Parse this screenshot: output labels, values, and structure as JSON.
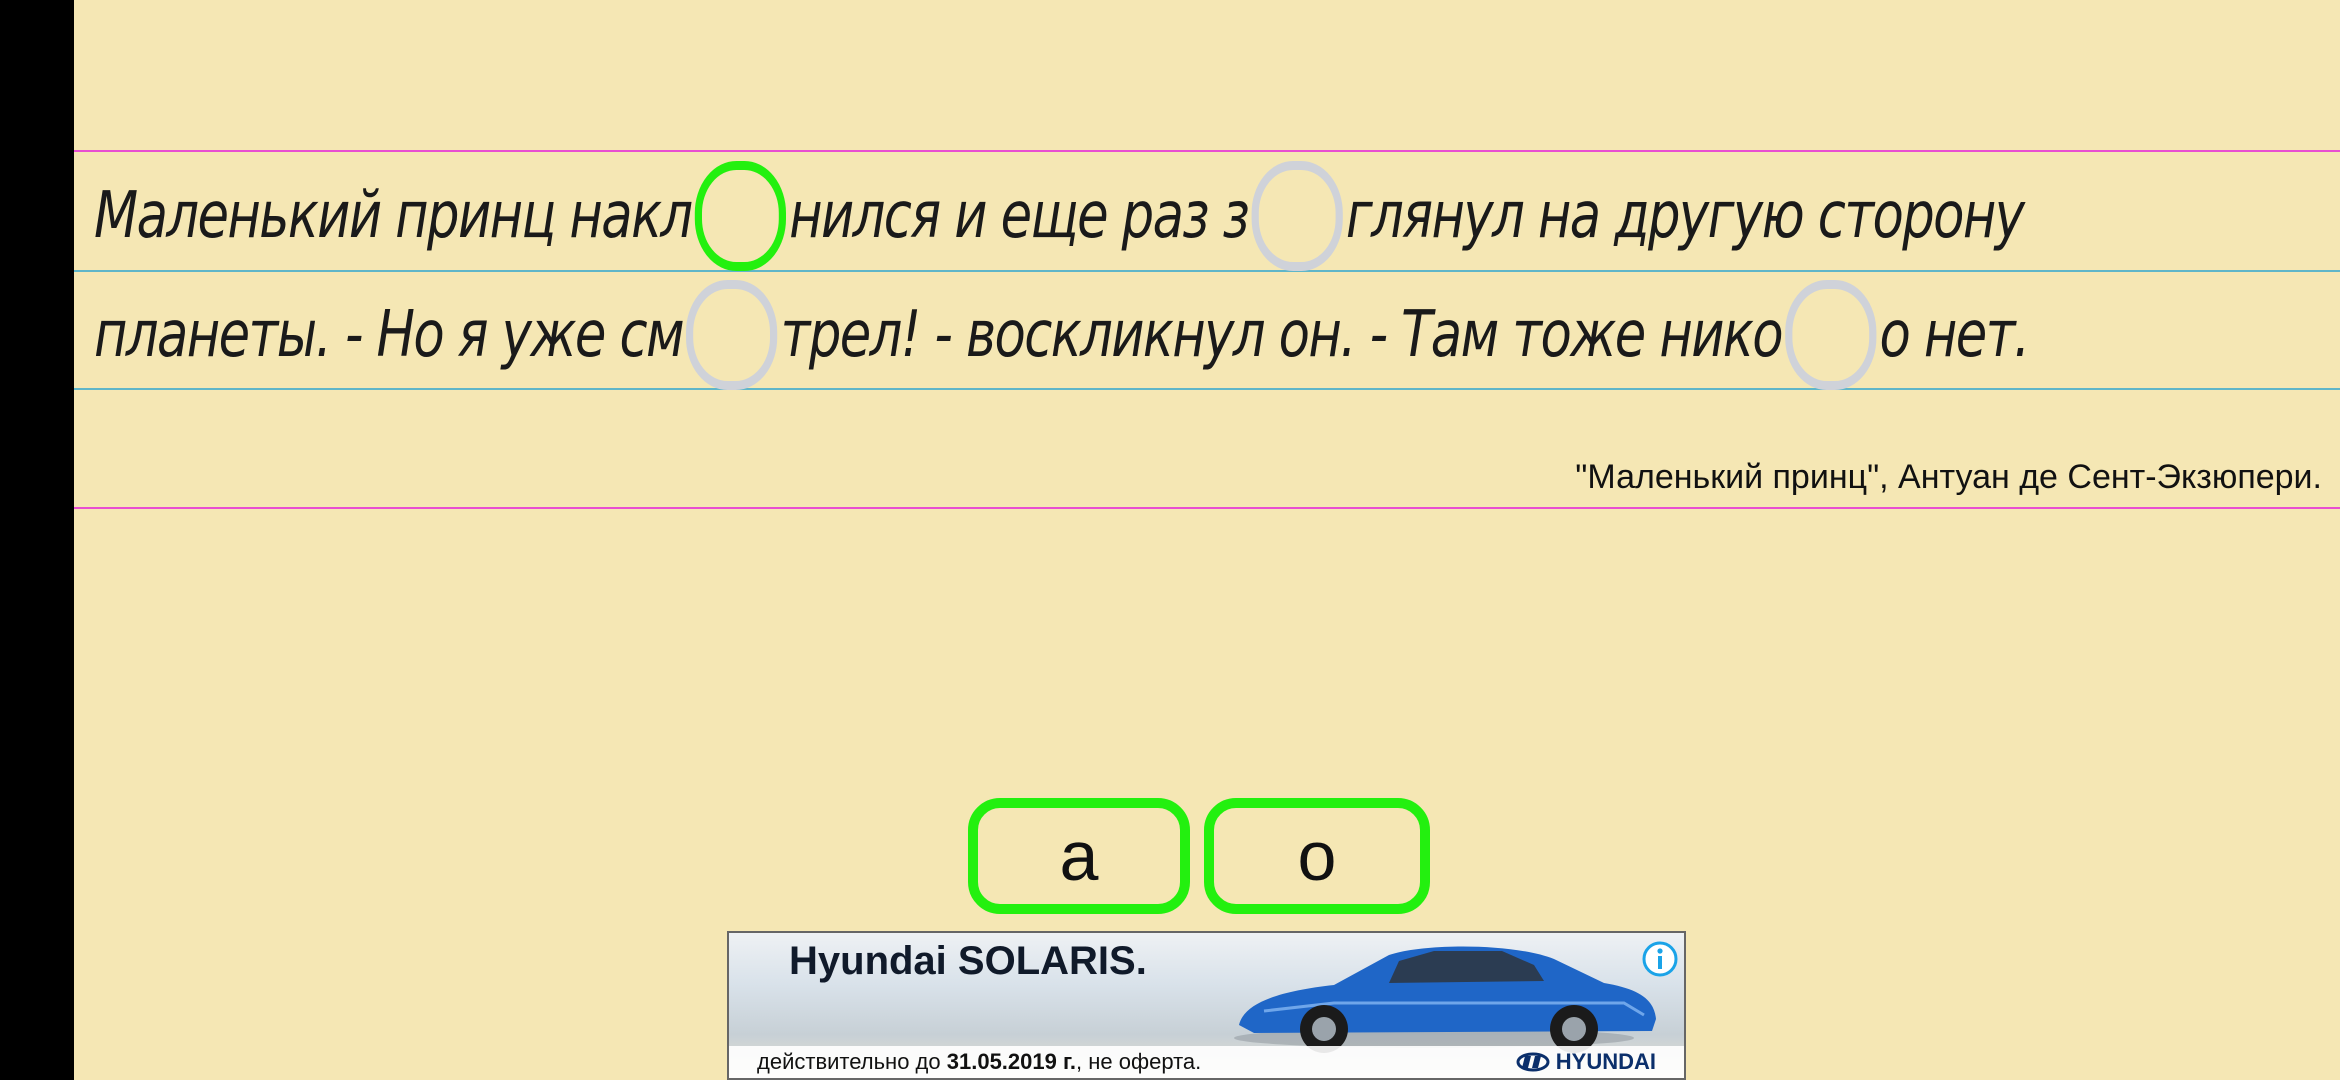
{
  "exercise": {
    "lines": [
      [
        "Маленький принц накл",
        "нился и еще раз з",
        "глянул на другую сторону"
      ],
      [
        "планеты. - Но я уже см",
        "трел! - воскликнул он. - Там тоже нико",
        "о нет."
      ]
    ],
    "attribution": "\"Маленький принц\", Антуан де Сент-Экзюпери."
  },
  "choices": [
    "а",
    "о"
  ],
  "ad": {
    "headline": "Hyundai SOLARIS.",
    "disclaimer_prefix": "действительно до",
    "disclaimer_date": "31.05.2019 г.",
    "disclaimer_suffix": ", не оферта.",
    "brand": "HYUNDAI"
  },
  "colors": {
    "background": "#f5e7b4",
    "active_gap": "#23f00f",
    "empty_gap": "#cfd2d9",
    "rule_pink": "#e84fd1",
    "rule_blue": "#5fb6c9"
  },
  "icons": [
    "info-icon",
    "hyundai-logo-icon"
  ]
}
